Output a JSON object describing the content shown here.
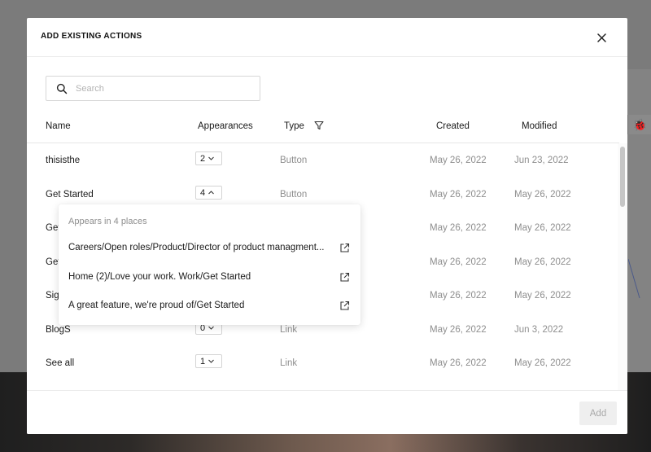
{
  "modal": {
    "title": "ADD EXISTING ACTIONS",
    "search_placeholder": "Search",
    "columns": {
      "name": "Name",
      "appearances": "Appearances",
      "type": "Type",
      "created": "Created",
      "modified": "Modified"
    },
    "rows": [
      {
        "name": "thisisthe",
        "appearances": "2",
        "expanded": false,
        "type": "Button",
        "created": "May 26, 2022",
        "modified": "Jun 23, 2022"
      },
      {
        "name": "Get Started",
        "appearances": "4",
        "expanded": true,
        "type": "Button",
        "created": "May 26, 2022",
        "modified": "May 26, 2022"
      },
      {
        "name": "Get",
        "appearances": "",
        "expanded": false,
        "type": "",
        "created": "May 26, 2022",
        "modified": "May 26, 2022"
      },
      {
        "name": "Get",
        "appearances": "",
        "expanded": false,
        "type": "",
        "created": "May 26, 2022",
        "modified": "May 26, 2022"
      },
      {
        "name": "Sig",
        "appearances": "",
        "expanded": false,
        "type": "",
        "created": "May 26, 2022",
        "modified": "May 26, 2022"
      },
      {
        "name": "BlogS",
        "appearances": "0",
        "expanded": false,
        "type": "Link",
        "created": "May 26, 2022",
        "modified": "Jun 3, 2022"
      },
      {
        "name": "See all",
        "appearances": "1",
        "expanded": false,
        "type": "Link",
        "created": "May 26, 2022",
        "modified": "May 26, 2022"
      }
    ],
    "popover": {
      "title": "Appears in 4 places",
      "items": [
        "Careers/Open roles/Product/Director of product managment...",
        "Home (2)/Love your work. Work/Get Started",
        "A great feature, we're proud of/Get Started"
      ]
    },
    "add_label": "Add"
  },
  "icons": {
    "close": "close-icon",
    "search": "search-icon",
    "filter": "filter-icon",
    "chevron_down": "chevron-down-icon",
    "chevron_up": "chevron-up-icon",
    "external_link": "external-link-icon",
    "ladybug": "ladybug-icon"
  },
  "colors": {
    "overlay": "#7b7b7b",
    "modal_bg": "#ffffff",
    "muted_text": "#8e8e8e",
    "add_button_bg": "#efefef"
  }
}
